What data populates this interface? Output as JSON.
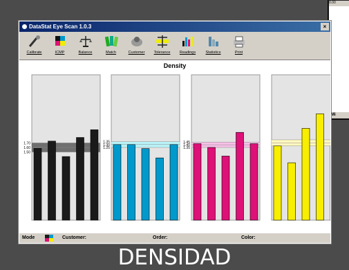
{
  "window": {
    "title": "DataStat Eye Scan 1.0.3",
    "close_label": "×"
  },
  "toolbar": {
    "items": [
      {
        "label": "Calibrate",
        "icon": "probe-icon"
      },
      {
        "label": "ICMP",
        "icon": "color-patch-icon"
      },
      {
        "label": "Balance",
        "icon": "scale-icon"
      },
      {
        "label": "Match",
        "icon": "swatch-icon"
      },
      {
        "label": "Customer",
        "icon": "customer-icon"
      },
      {
        "label": "Tolerance",
        "icon": "tolerance-icon"
      },
      {
        "label": "Readings",
        "icon": "readings-icon"
      },
      {
        "label": "Statistics",
        "icon": "statistics-icon"
      },
      {
        "label": "Print",
        "icon": "print-icon"
      }
    ]
  },
  "colors": {
    "black": "#1a1a1a",
    "cyan": "#0099cc",
    "magenta": "#dd1177",
    "yellow": "#f7ee00"
  },
  "chart_data": {
    "type": "bar",
    "title": "Density",
    "panels": [
      {
        "name": "black",
        "color": "#1a1a1a",
        "band_color": "#6f6f6f",
        "tick_labels": [
          "1.70",
          "1.60",
          "1.50"
        ],
        "band": [
          1.5,
          1.7
        ],
        "range": [
          0.0,
          3.2
        ],
        "values": [
          1.58,
          1.74,
          1.4,
          1.82,
          1.99
        ]
      },
      {
        "name": "cyan",
        "color": "#0099cc",
        "band_color": "#b8f3f8",
        "tick_labels": [
          "1.35",
          "1.30",
          "1.25"
        ],
        "band": [
          1.25,
          1.35
        ],
        "range": [
          0.0,
          2.5
        ],
        "values": [
          1.3,
          1.3,
          1.23,
          1.07,
          1.3
        ]
      },
      {
        "name": "magenta",
        "color": "#dd1177",
        "band_color": "#f8c0e8",
        "tick_labels": [
          "1.45",
          "1.40",
          "1.35"
        ],
        "band": [
          1.35,
          1.45
        ],
        "range": [
          0.0,
          2.7
        ],
        "values": [
          1.42,
          1.35,
          1.19,
          1.63,
          1.42
        ]
      },
      {
        "name": "yellow",
        "color": "#f7ee00",
        "band_color": "#fff8c0",
        "tick_labels": [
          "",
          "",
          ""
        ],
        "band": [
          0.97,
          1.05
        ],
        "range": [
          0.0,
          1.9
        ],
        "values": [
          0.97,
          0.75,
          1.2,
          1.39,
          0.97
        ]
      }
    ]
  },
  "statusbar": {
    "mode": "Mode",
    "customer": "Customer:",
    "order": "Order:",
    "color": "Color:"
  },
  "back_window": {
    "label": "Mi",
    "header": "0.00"
  },
  "caption": "DENSIDAD"
}
